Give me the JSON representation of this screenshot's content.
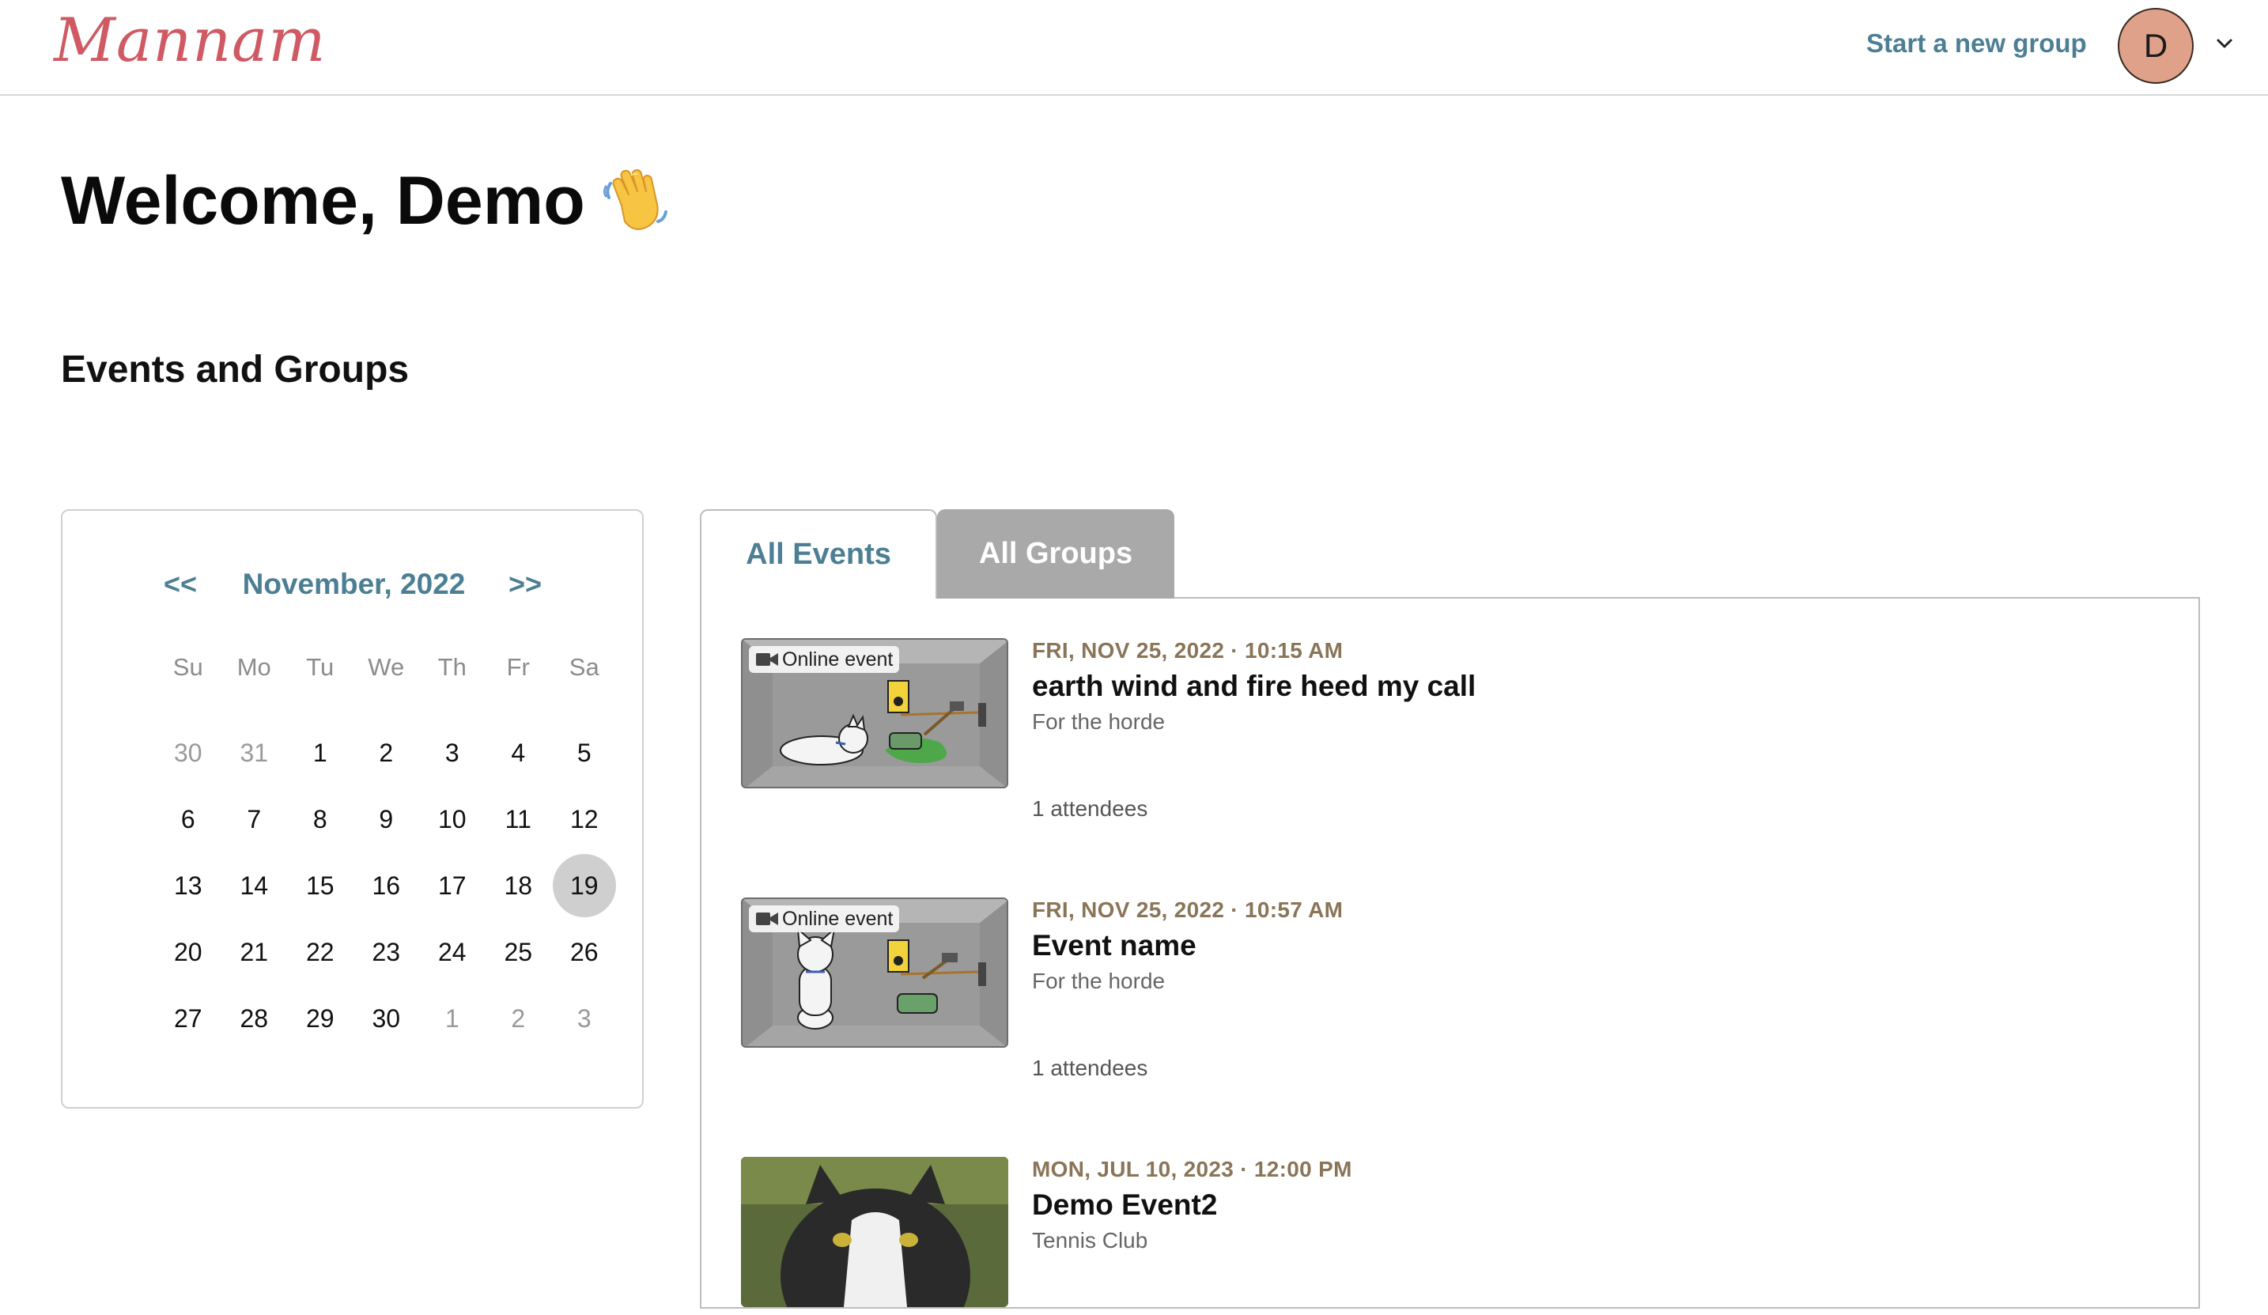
{
  "header": {
    "logo": "Mannam",
    "start_group": "Start a new group",
    "avatar_initial": "D"
  },
  "welcome": {
    "text": "Welcome, Demo",
    "emoji_icon": "waving-hand-icon"
  },
  "section_title": "Events and Groups",
  "calendar": {
    "prev": "<<",
    "next": ">>",
    "month_label": "November, 2022",
    "weekdays": [
      "Su",
      "Mo",
      "Tu",
      "We",
      "Th",
      "Fr",
      "Sa"
    ],
    "weeks": [
      [
        "30",
        "31",
        "1",
        "2",
        "3",
        "4",
        "5"
      ],
      [
        "6",
        "7",
        "8",
        "9",
        "10",
        "11",
        "12"
      ],
      [
        "13",
        "14",
        "15",
        "16",
        "17",
        "18",
        "19"
      ],
      [
        "20",
        "21",
        "22",
        "23",
        "24",
        "25",
        "26"
      ],
      [
        "27",
        "28",
        "29",
        "30",
        "1",
        "2",
        "3"
      ]
    ],
    "selected_day": "19"
  },
  "tabs": {
    "events": "All Events",
    "groups": "All Groups",
    "active": "events"
  },
  "events": [
    {
      "date": "FRI, NOV 25, 2022 · 10:15 AM",
      "title": "earth wind and fire heed my call",
      "group": "For the horde",
      "attendees": "1 attendees",
      "badge": "Online event"
    },
    {
      "date": "FRI, NOV 25, 2022 · 10:57 AM",
      "title": "Event name",
      "group": "For the horde",
      "attendees": "1 attendees",
      "badge": "Online event"
    },
    {
      "date": "MON, JUL 10, 2023 · 12:00 PM",
      "title": "Demo Event2",
      "group": "Tennis Club"
    }
  ],
  "colors": {
    "accent": "#4c7f94",
    "logo": "#cf5a63",
    "date": "#8a7558",
    "avatar": "#e0a18a",
    "tab_inactive": "#a9a9a9"
  }
}
